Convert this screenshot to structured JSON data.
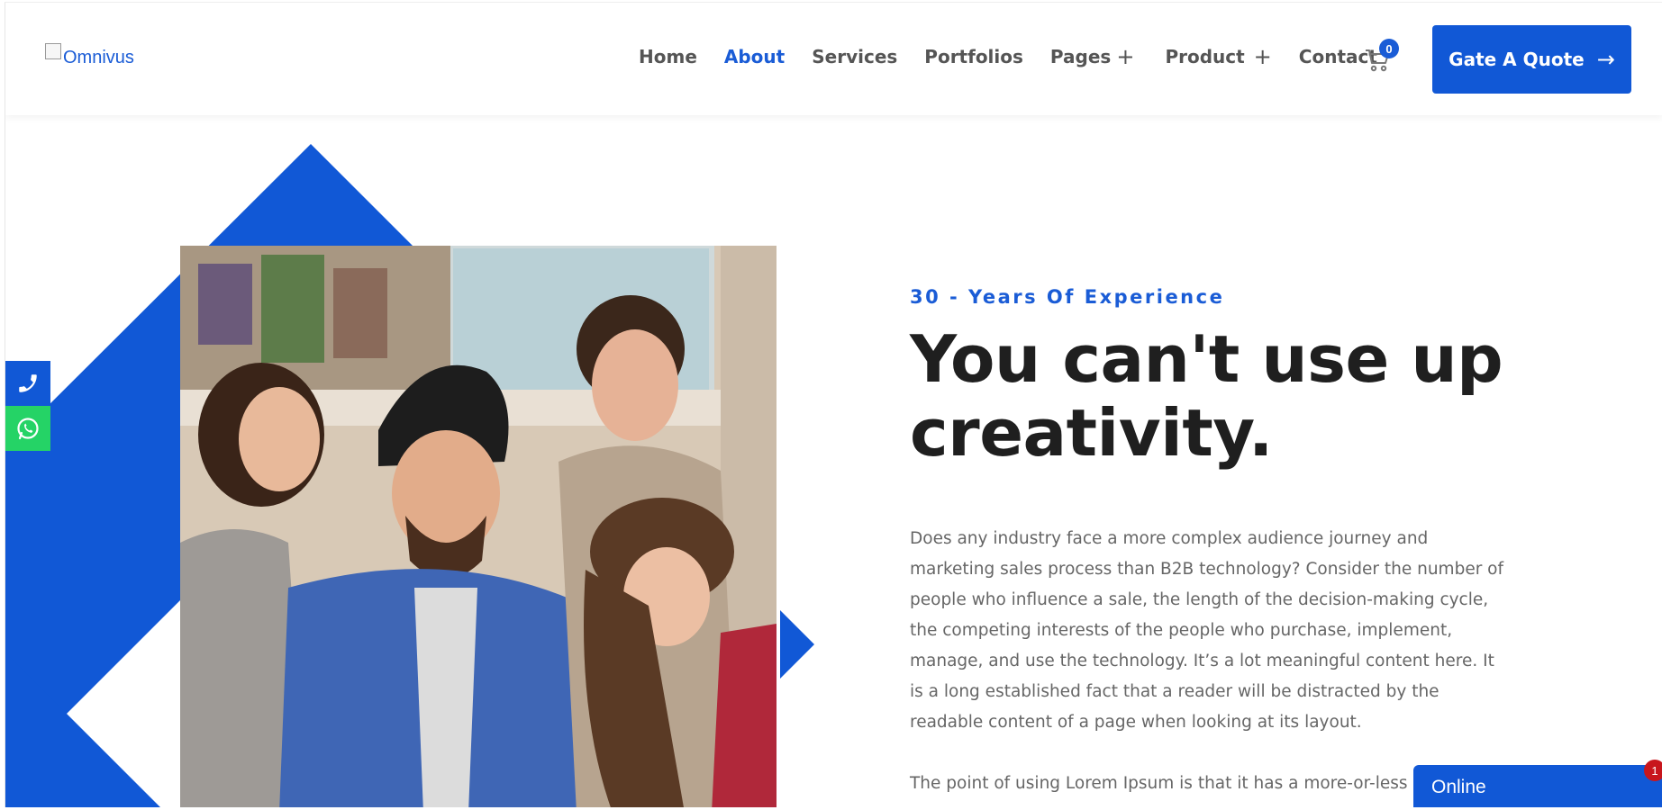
{
  "brand": {
    "logo_alt": "Omnivus",
    "accent": "#1158d6",
    "whatsapp": "#25d366"
  },
  "nav": {
    "items": [
      {
        "label": "Home",
        "active": false,
        "has_submenu": false
      },
      {
        "label": "About",
        "active": true,
        "has_submenu": false
      },
      {
        "label": "Services",
        "active": false,
        "has_submenu": false
      },
      {
        "label": "Portfolios",
        "active": false,
        "has_submenu": false
      },
      {
        "label": "Pages",
        "active": false,
        "has_submenu": true
      },
      {
        "label": "Product",
        "active": false,
        "has_submenu": true
      },
      {
        "label": "Contact",
        "active": false,
        "has_submenu": false
      }
    ],
    "submenu_icon": "+"
  },
  "cart": {
    "count": "0",
    "icon": "cart-icon"
  },
  "cta": {
    "label": "Gate A Quote",
    "arrow": "→"
  },
  "side_contacts": [
    {
      "name": "phone",
      "icon": "phone-icon"
    },
    {
      "name": "whatsapp",
      "icon": "whatsapp-icon"
    }
  ],
  "hero": {
    "subtitle": "30 - Years Of Experience",
    "title_line1": "You can't use up",
    "title_line2": "creativity.",
    "paragraph1": "Does any industry face a more complex audience journey and marketing sales process than B2B technology? Consider the number of people who influence a sale, the length of the decision-making cycle, the competing interests of the people who purchase, implement, manage, and use the technology. It’s a lot meaningful content here. It is a long established fact that a reader will be distracted by the readable content of a page when looking at its layout.",
    "paragraph2": "The point of using Lorem Ipsum is that it has a more-or-less"
  },
  "chat": {
    "label": "Online",
    "badge": "1"
  }
}
